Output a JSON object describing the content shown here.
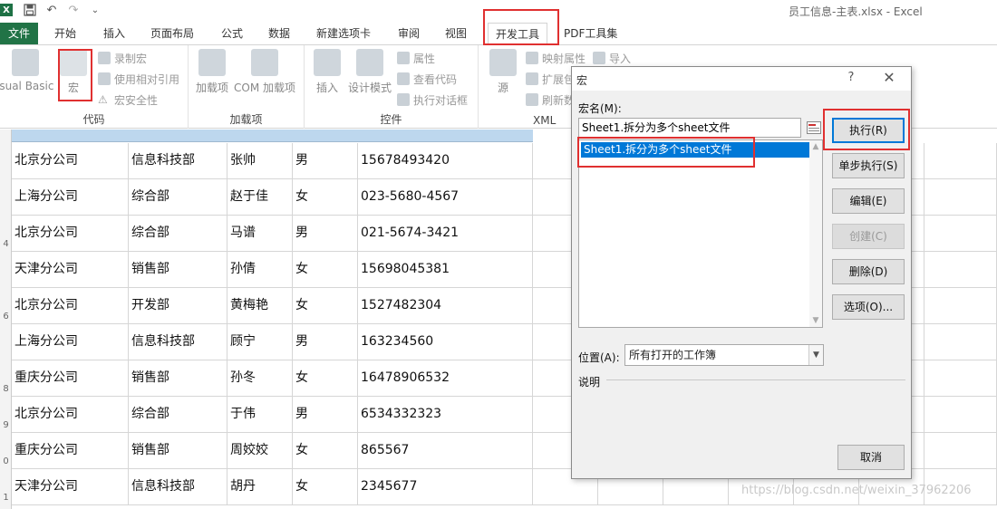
{
  "window": {
    "title": "员工信息-主表.xlsx - Excel"
  },
  "qat": {
    "logo": "X",
    "undo_icon": "↶",
    "redo_icon": "↷",
    "more_icon": "⌄"
  },
  "tabs": {
    "file": "文件",
    "home": "开始",
    "insert": "插入",
    "page_layout": "页面布局",
    "formulas": "公式",
    "data": "数据",
    "new_tab": "新建选项卡",
    "review": "审阅",
    "view": "视图",
    "developer": "开发工具",
    "pdf_tools": "PDF工具集"
  },
  "ribbon": {
    "code": {
      "label": "代码",
      "visual_basic": "isual Basic",
      "macros": "宏",
      "record_macro": "录制宏",
      "use_relative": "使用相对引用",
      "macro_security": "宏安全性"
    },
    "addins": {
      "label": "加载项",
      "addins": "加载项",
      "com_addins": "COM 加载项"
    },
    "controls": {
      "label": "控件",
      "insert": "插入",
      "design_mode": "设计模式",
      "properties": "属性",
      "view_code": "查看代码",
      "run_dialog": "执行对话框"
    },
    "xml": {
      "label": "XML",
      "source": "源",
      "map_properties": "映射属性",
      "import": "导入",
      "expansion": "扩展包",
      "refresh": "刷新数"
    }
  },
  "sheet": {
    "rows": [
      {
        "num": "",
        "company": "北京分公司",
        "dept": "信息科技部",
        "name": "张帅",
        "gender": "男",
        "phone": "15678493420"
      },
      {
        "num": "",
        "company": "上海分公司",
        "dept": "综合部",
        "name": "赵于佳",
        "gender": "女",
        "phone": "023-5680-4567"
      },
      {
        "num": "4",
        "company": "北京分公司",
        "dept": "综合部",
        "name": "马谱",
        "gender": "男",
        "phone": "021-5674-3421"
      },
      {
        "num": "",
        "company": "天津分公司",
        "dept": "销售部",
        "name": "孙倩",
        "gender": "女",
        "phone": "15698045381"
      },
      {
        "num": "6",
        "company": "北京分公司",
        "dept": "开发部",
        "name": "黄梅艳",
        "gender": "女",
        "phone": "1527482304"
      },
      {
        "num": "",
        "company": "上海分公司",
        "dept": "信息科技部",
        "name": "顾宁",
        "gender": "男",
        "phone": "163234560"
      },
      {
        "num": "8",
        "company": "重庆分公司",
        "dept": "销售部",
        "name": "孙冬",
        "gender": "女",
        "phone": "16478906532"
      },
      {
        "num": "9",
        "company": "北京分公司",
        "dept": "综合部",
        "name": "于伟",
        "gender": "男",
        "phone": "6534332323"
      },
      {
        "num": "0",
        "company": "重庆分公司",
        "dept": "销售部",
        "name": "周姣姣",
        "gender": "女",
        "phone": "865567"
      },
      {
        "num": "1",
        "company": "天津分公司",
        "dept": "信息科技部",
        "name": "胡丹",
        "gender": "女",
        "phone": "2345677"
      }
    ]
  },
  "dialog": {
    "title": "宏",
    "help": "?",
    "close": "✕",
    "macro_name_label": "宏名(M):",
    "macro_name_value": "Sheet1.拆分为多个sheet文件",
    "list_items": [
      "Sheet1.拆分为多个sheet文件"
    ],
    "buttons": {
      "run": "执行(R)",
      "step_into": "单步执行(S)",
      "edit": "编辑(E)",
      "create": "创建(C)",
      "delete": "删除(D)",
      "options": "选项(O)...",
      "cancel": "取消"
    },
    "location_label": "位置(A):",
    "location_value": "所有打开的工作簿",
    "description_label": "说明"
  },
  "watermark": "https://blog.csdn.net/weixin_37962206",
  "colors": {
    "accent": "#217346",
    "highlight": "#e03030",
    "selection": "#0078d7"
  }
}
